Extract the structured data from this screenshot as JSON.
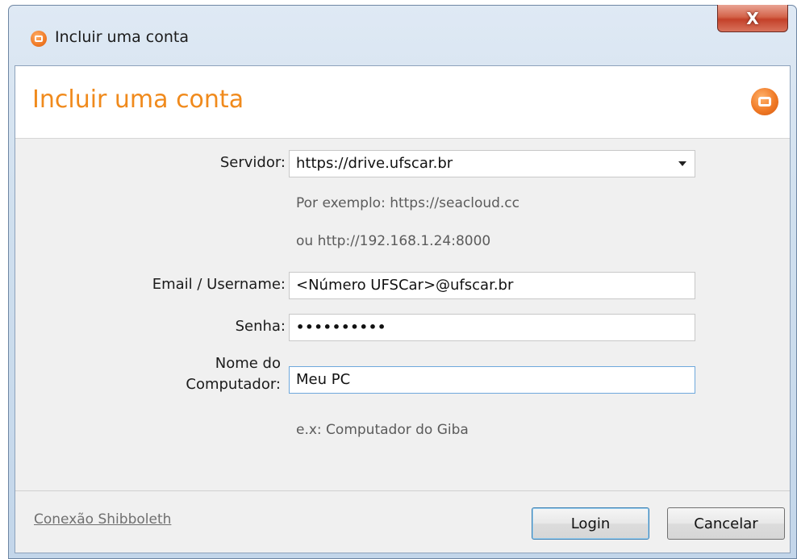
{
  "window": {
    "title": "Incluir uma conta",
    "close_label": "X"
  },
  "header": {
    "title": "Incluir uma conta"
  },
  "form": {
    "server": {
      "label": "Servidor:",
      "value": "https://drive.ufscar.br",
      "hint_1": "Por exemplo: https://seacloud.cc",
      "hint_2": "ou http://192.168.1.24:8000"
    },
    "email": {
      "label": "Email / Username:",
      "value": "<Número UFSCar>@ufscar.br"
    },
    "password": {
      "label": "Senha:",
      "value": "••••••••••"
    },
    "computer_name": {
      "label_line1": "Nome do",
      "label_line2": "Computador:",
      "value": "Meu PC",
      "hint": "e.x: Computador do Giba"
    }
  },
  "footer": {
    "shibboleth_link": "Conexão Shibboleth",
    "login_label": "Login",
    "cancel_label": "Cancelar"
  },
  "colors": {
    "accent": "#f08a1c",
    "focus_border": "#6ea8dc"
  }
}
